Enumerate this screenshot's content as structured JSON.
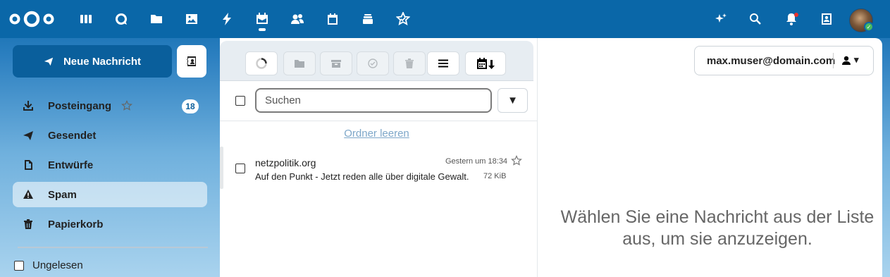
{
  "topbar": {
    "apps": [
      "dashboard-icon",
      "talk-icon",
      "files-icon",
      "photos-icon",
      "activity-icon",
      "mail-icon",
      "contacts-icon",
      "calendar-icon",
      "deck-icon",
      "tasks-icon"
    ],
    "right_icons": [
      "assistant-icon",
      "search-icon",
      "notifications-icon",
      "contacts-menu-icon"
    ],
    "accent": "#0a67a8"
  },
  "nav": {
    "compose_label": "Neue Nachricht",
    "items": [
      {
        "label": "Posteingang",
        "badge": "18",
        "icon": "inbox-icon"
      },
      {
        "label": "Gesendet",
        "icon": "send-icon"
      },
      {
        "label": "Entwürfe",
        "icon": "draft-icon"
      },
      {
        "label": "Spam",
        "icon": "warning-icon"
      },
      {
        "label": "Papierkorb",
        "icon": "trash-icon"
      }
    ],
    "unread_label": "Ungelesen"
  },
  "list": {
    "search_placeholder": "Suchen",
    "filter_symbol": "▼",
    "empty_folder_label": "Ordner leeren",
    "messages": [
      {
        "from": "netzpolitik.org",
        "subject": "Auf den Punkt - Jetzt reden alle über digitale Gewalt.",
        "date": "Gestern um 18:34",
        "size": "72 KiB"
      }
    ]
  },
  "reader": {
    "account": "max.muser@domain.com",
    "account_caret": "▾",
    "placeholder": "Wählen Sie eine Nachricht aus der Liste aus, um sie anzuzeigen."
  }
}
